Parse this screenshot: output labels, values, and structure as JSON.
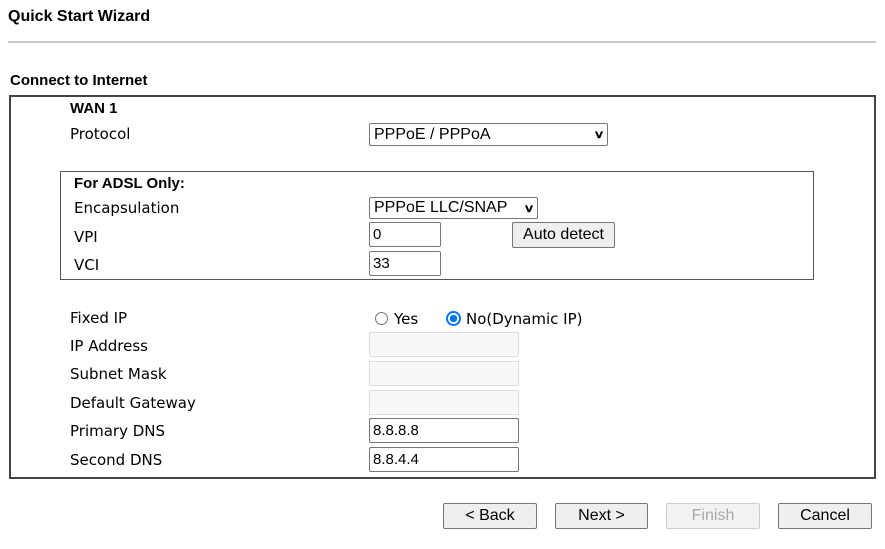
{
  "title": "Quick Start Wizard",
  "section": "Connect to Internet",
  "wan": "WAN 1",
  "protocol": {
    "label": "Protocol",
    "value": "PPPoE / PPPoA"
  },
  "adsl": {
    "heading": "For ADSL Only:",
    "encapsulation": {
      "label": "Encapsulation",
      "value": "PPPoE LLC/SNAP"
    },
    "vpi": {
      "label": "VPI",
      "value": "0"
    },
    "vci": {
      "label": "VCI",
      "value": "33"
    },
    "auto_detect": "Auto detect"
  },
  "fixed_ip": {
    "label": "Fixed IP",
    "yes": "Yes",
    "no": "No(Dynamic IP)",
    "selected": "no"
  },
  "ip_address": {
    "label": "IP Address",
    "value": ""
  },
  "subnet_mask": {
    "label": "Subnet Mask",
    "value": ""
  },
  "default_gateway": {
    "label": "Default Gateway",
    "value": ""
  },
  "primary_dns": {
    "label": "Primary DNS",
    "value": "8.8.8.8"
  },
  "second_dns": {
    "label": "Second DNS",
    "value": "8.8.4.4"
  },
  "buttons": {
    "back": "< Back",
    "next": "Next >",
    "finish": "Finish",
    "cancel": "Cancel"
  }
}
